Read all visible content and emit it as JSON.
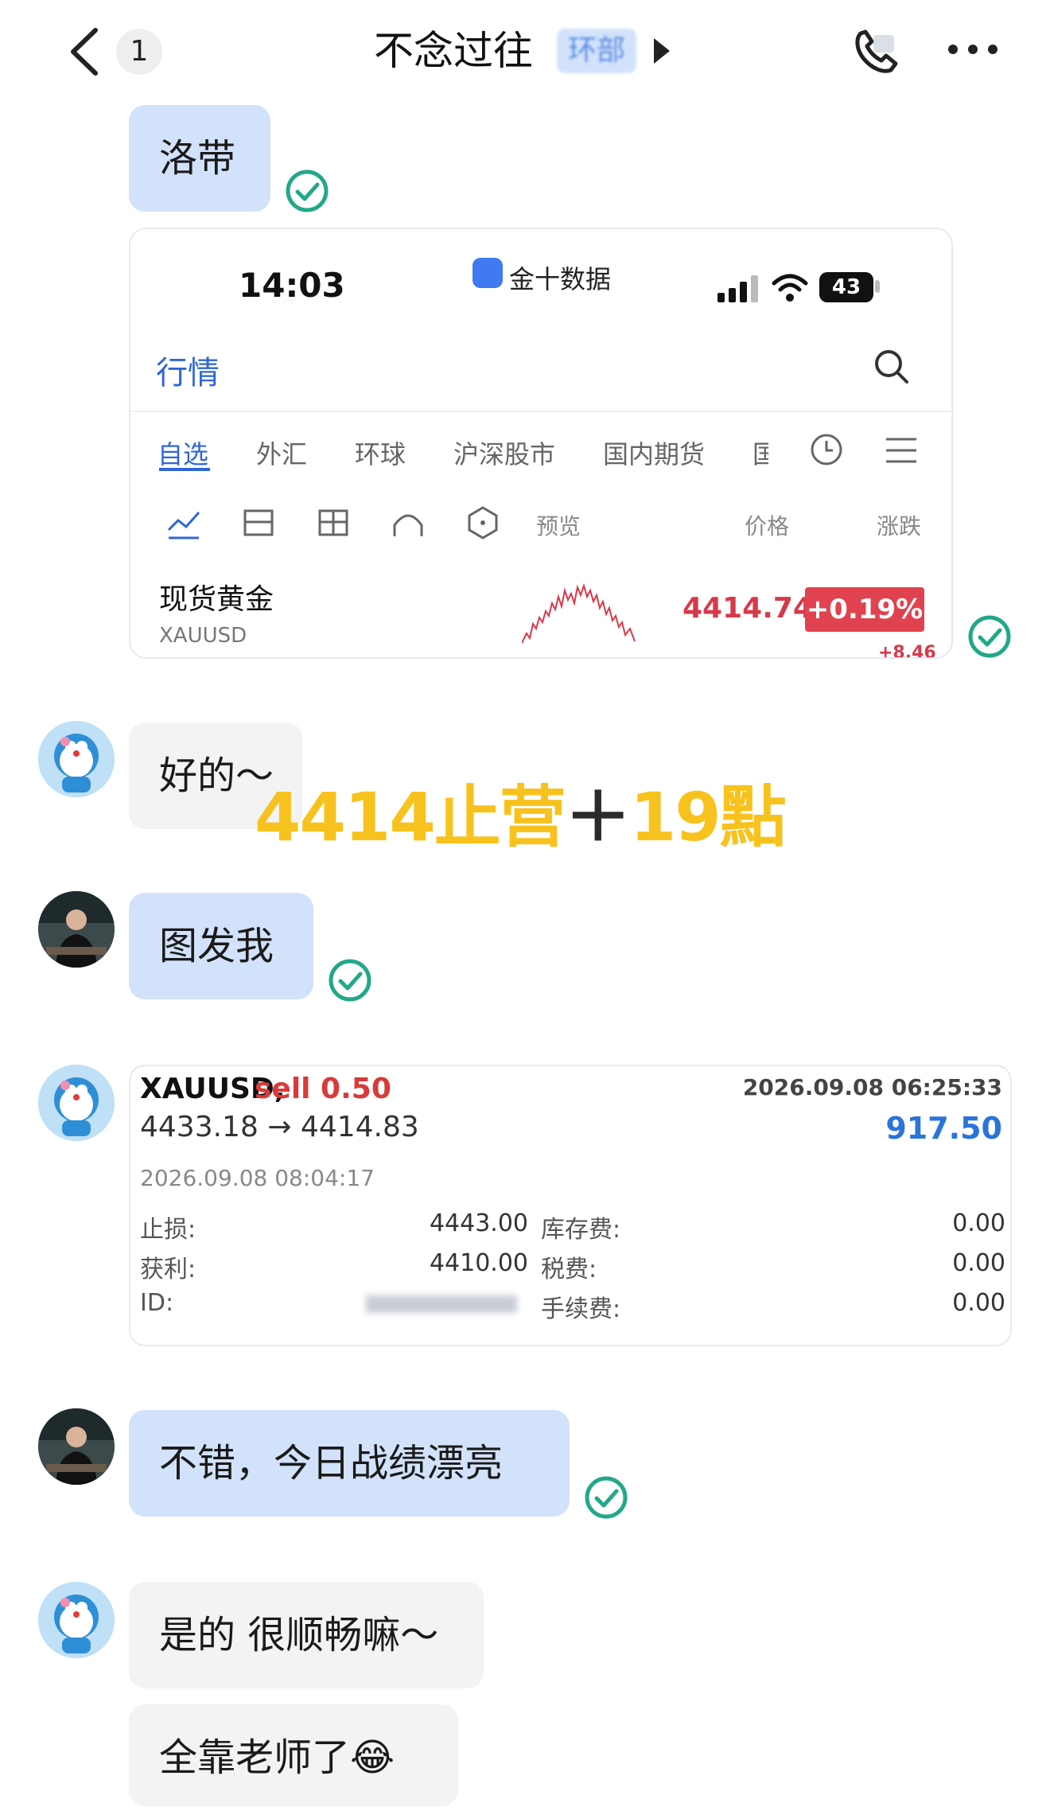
{
  "header": {
    "unread_count": "1",
    "chat_title": "不念过往",
    "group_tag": "环部"
  },
  "messages": [
    {
      "text": "洛带"
    },
    {
      "text": "好的～"
    },
    {
      "text": "图发我"
    },
    {
      "text": "不错，今日战绩漂亮"
    },
    {
      "text": "是的 很顺畅嘛～"
    },
    {
      "text": "全靠老师了😂"
    }
  ],
  "screenshot_card": {
    "time": "14:03",
    "app_name": "金十数据",
    "battery": "43",
    "page_title": "行情",
    "tabs": [
      "自选",
      "外汇",
      "环球",
      "沪深股市",
      "国内期货",
      "国"
    ],
    "columns": [
      "预览",
      "价格",
      "涨跌"
    ],
    "instrument_name": "现货黄金",
    "instrument_code": "XAUUSD",
    "price": "4414.74",
    "change_pct": "+0.19%",
    "change_pts": "+8.46"
  },
  "overlay": {
    "part1": "4414止营",
    "plus": "＋",
    "part2": "19點"
  },
  "trade_card": {
    "symbol": "XAUUSD,",
    "side": "sell 0.50",
    "close_time": "2026.09.08 06:25:33",
    "prices": "4433.18 → 4414.83",
    "profit": "917.50",
    "open_time": "2026.09.08 08:04:17",
    "rows": [
      {
        "label": "止损:",
        "value": "4443.00",
        "label2": "库存费:",
        "value2": "0.00"
      },
      {
        "label": "获利:",
        "value": "4410.00",
        "label2": "税费:",
        "value2": "0.00"
      },
      {
        "label": "ID:",
        "value": "",
        "label2": "手续费:",
        "value2": "0.00"
      }
    ]
  },
  "colors": {
    "my_bubble": "#d2e2fb",
    "their_bubble": "#f3f3f3",
    "read_check": "#22a889",
    "overlay_yellow": "#f8c21e",
    "price_red": "#d63a4a",
    "profit_blue": "#2a74d9"
  }
}
